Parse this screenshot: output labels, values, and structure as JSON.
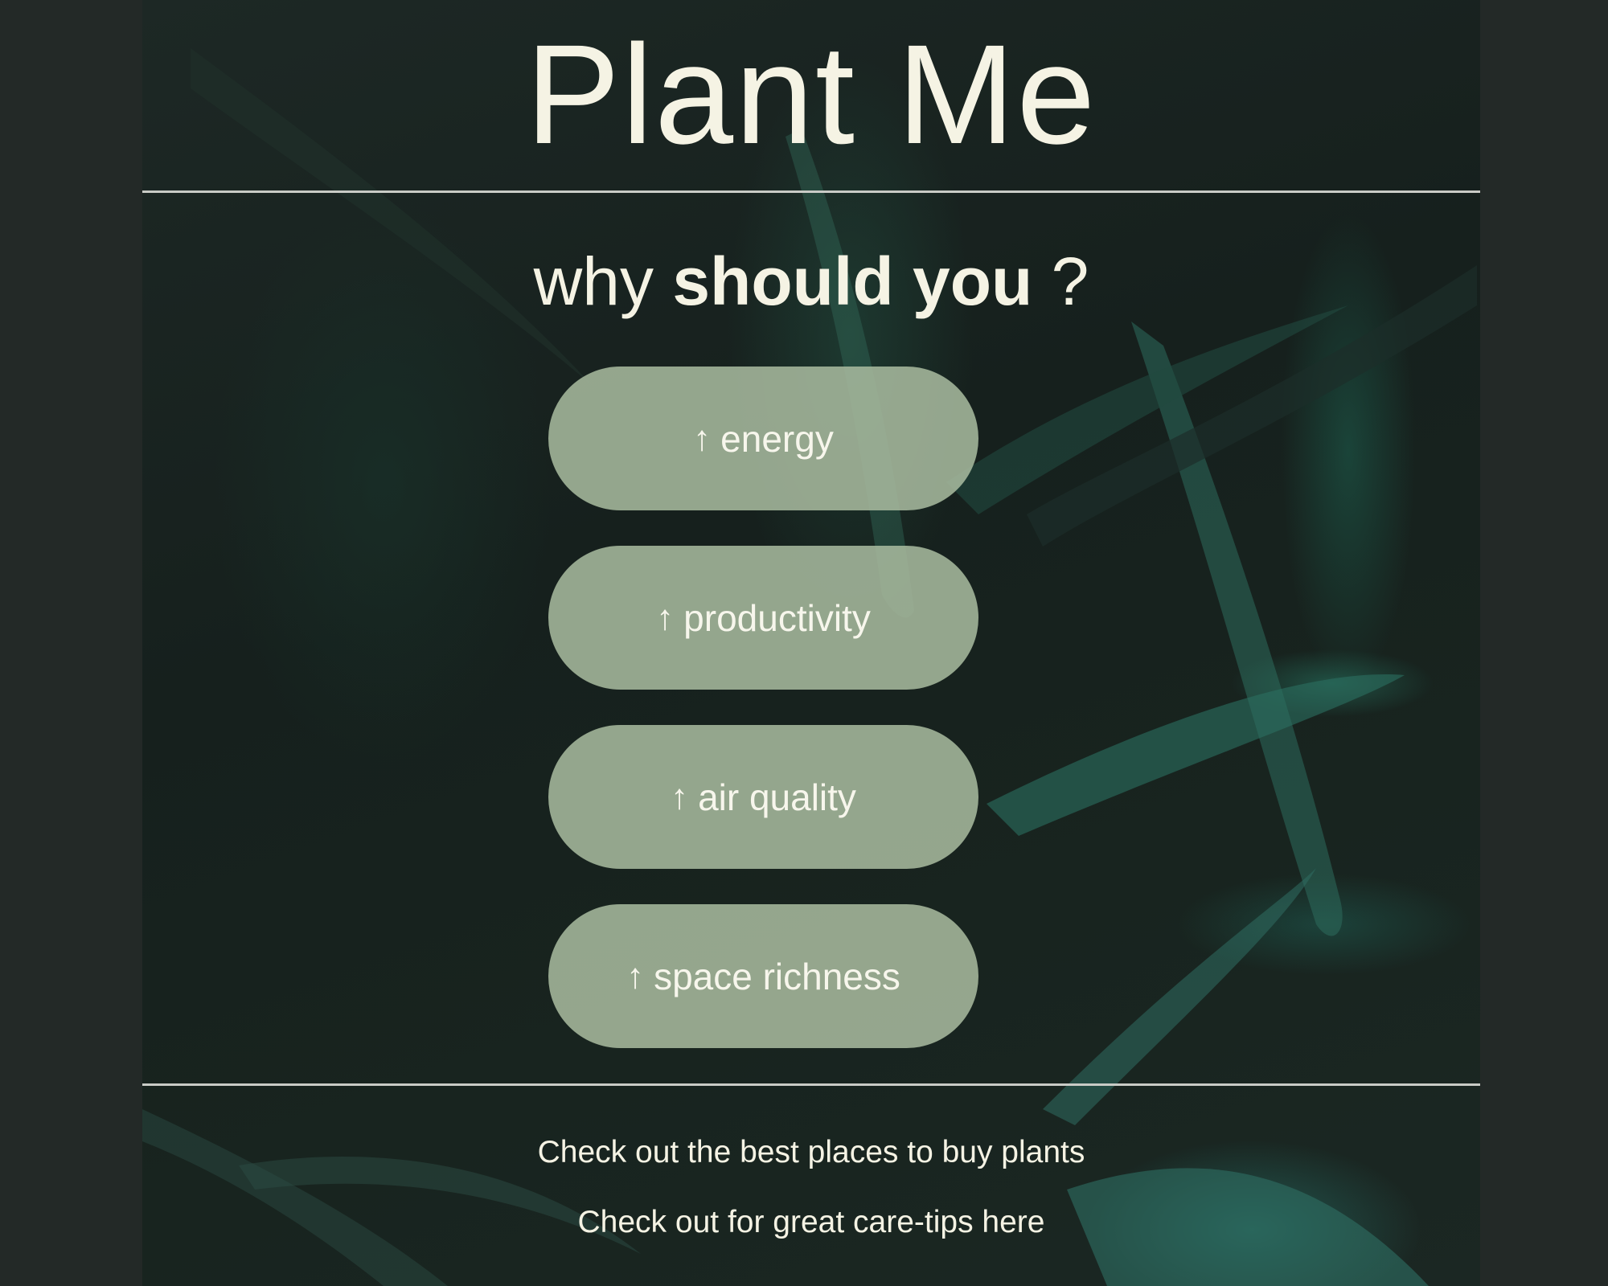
{
  "header": {
    "title": "Plant Me"
  },
  "subtitle": {
    "prefix": "why",
    "emphasis": "should you",
    "suffix": "?"
  },
  "benefits": [
    {
      "arrow": "↑",
      "label": "energy"
    },
    {
      "arrow": "↑",
      "label": "productivity"
    },
    {
      "arrow": "↑",
      "label": "air quality"
    },
    {
      "arrow": "↑",
      "label": "space richness"
    }
  ],
  "footer": {
    "buy_link": "Check out the best places to buy plants",
    "tips_link": "Check out for great care-tips here"
  },
  "colors": {
    "page_background": "#232927",
    "pill_background": "#a6b89d",
    "text": "#f5f3e4",
    "divider": "#c9cbc6"
  }
}
